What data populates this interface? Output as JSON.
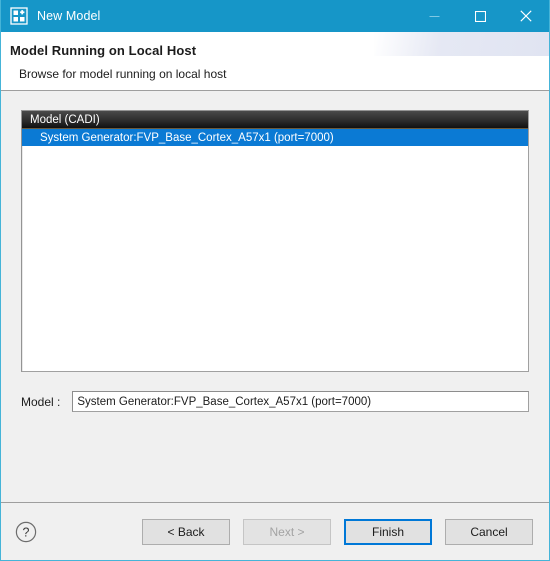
{
  "window": {
    "title": "New Model",
    "icon": "new-model-icon",
    "accent_color": "#1696c8",
    "border_color": "#45b4d8",
    "body_color": "#f0f0f0",
    "controls": [
      {
        "name": "minimize",
        "glyph": "minimize-icon"
      },
      {
        "name": "maximize",
        "glyph": "maximize-icon"
      },
      {
        "name": "close",
        "glyph": "close-icon"
      }
    ]
  },
  "header": {
    "title": "Model Running on Local Host",
    "description": "Browse for model running on local host"
  },
  "list": {
    "columns": [
      "Model (CADI)"
    ],
    "rows": [
      {
        "label": "System Generator:FVP_Base_Cortex_A57x1 (port=7000)",
        "selected": true
      }
    ],
    "selection_color": "#0b7ad4",
    "header_color": "#2d2d2d"
  },
  "model_field": {
    "label": "Model :",
    "value": "System Generator:FVP_Base_Cortex_A57x1 (port=7000)",
    "placeholder": ""
  },
  "footer": {
    "help_icon": "help-circle-icon",
    "buttons": [
      {
        "label": "< Back",
        "state": "enabled"
      },
      {
        "label": "Next >",
        "state": "disabled"
      },
      {
        "label": "Finish",
        "state": "focused"
      },
      {
        "label": "Cancel",
        "state": "enabled"
      }
    ],
    "focus_color": "#0078d7"
  }
}
